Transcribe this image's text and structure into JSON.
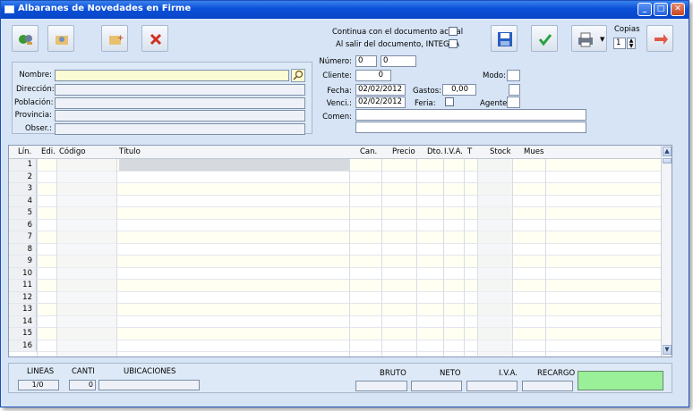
{
  "window": {
    "title": "Albaranes de Novedades en Firme"
  },
  "options": {
    "continua_label": "Continua con el documento actual",
    "salir_label": "Al salir del documento, INTEGRA",
    "copias_label": "Copias",
    "copias_value": "1"
  },
  "client": {
    "nombre_label": "Nombre:",
    "direccion_label": "Dirección:",
    "poblacion_label": "Población:",
    "provincia_label": "Provincia:",
    "obser_label": "Obser.:",
    "nombre_value": "",
    "direccion_value": "",
    "poblacion_value": "",
    "provincia_value": "",
    "obser_value": ""
  },
  "doc": {
    "numero_label": "Número:",
    "numero_value": "0",
    "numero_value2": "0",
    "cliente_label": "Cliente:",
    "cliente_value": "0",
    "modo_label": "Modo:",
    "fecha_label": "Fecha:",
    "fecha_value": "02/02/2012",
    "gastos_label": "Gastos:",
    "gastos_value": "0,00",
    "venci_label": "Venci.:",
    "venci_value": "02/02/2012",
    "feria_label": "Feria:",
    "agente_label": "Agente:",
    "comen_label": "Comen:"
  },
  "grid": {
    "columns": [
      "Lín.",
      "Edi.",
      "Código",
      "Título",
      "Can.",
      "Precio",
      "Dto.",
      "I.V.A.",
      "T",
      "Stock",
      "Mues"
    ],
    "rows": [
      "1",
      "2",
      "3",
      "4",
      "5",
      "6",
      "7",
      "8",
      "9",
      "10",
      "11",
      "12",
      "13",
      "14",
      "15",
      "16"
    ]
  },
  "footer": {
    "lineas_label": "LINEAS",
    "lineas_value": "1/0",
    "canti_label": "CANTI",
    "canti_value": "0",
    "ubicaciones_label": "UBICACIONES",
    "bruto_label": "BRUTO",
    "neto_label": "NETO",
    "iva_label": "I.V.A.",
    "recargo_label": "RECARGO",
    "total_color": "#99f099"
  }
}
